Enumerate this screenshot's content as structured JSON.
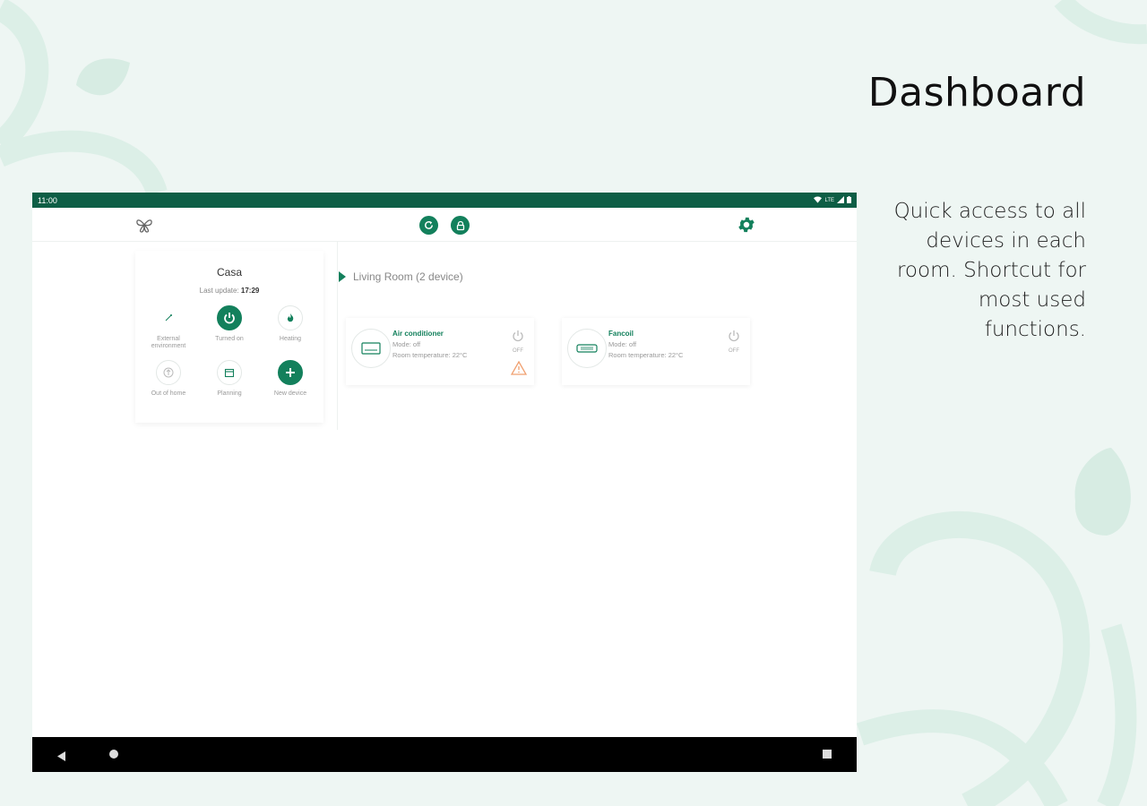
{
  "promo": {
    "title": "Dashboard",
    "description": "Quick access to all devices in each room. Shortcut for most used functions."
  },
  "status_bar": {
    "time": "11:00",
    "network": "LTE"
  },
  "home": {
    "name": "Casa",
    "last_update_label": "Last update:",
    "last_update_time": "17:29",
    "tiles": [
      {
        "label": "External environment",
        "icon": "thermometer-icon"
      },
      {
        "label": "Turned on",
        "icon": "power-icon"
      },
      {
        "label": "Heating",
        "icon": "flame-icon"
      },
      {
        "label": "Out of home",
        "icon": "away-icon"
      },
      {
        "label": "Planning",
        "icon": "calendar-icon"
      },
      {
        "label": "New device",
        "icon": "plus-icon"
      }
    ]
  },
  "room": {
    "title": "Living Room (2 device)"
  },
  "devices": [
    {
      "name": "Air conditioner",
      "mode": "Mode: off",
      "temperature": "Room temperature: 22°C",
      "state": "OFF",
      "warning": true
    },
    {
      "name": "Fancoil",
      "mode": "Mode: off",
      "temperature": "Room temperature: 22°C",
      "state": "OFF",
      "warning": false
    }
  ],
  "colors": {
    "accent": "#13805c",
    "status_bar": "#0d5e45",
    "warning": "#f0a070"
  }
}
